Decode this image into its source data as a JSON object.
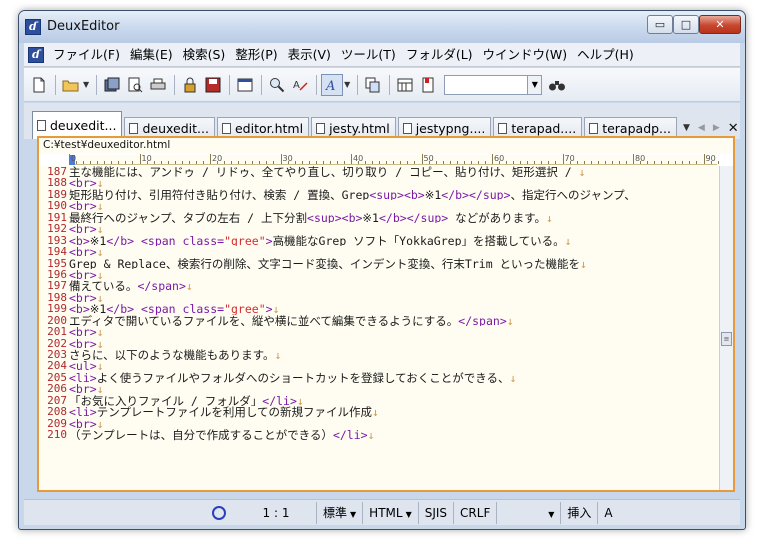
{
  "window": {
    "title": "DeuxEditor",
    "icon": "deuxeditor-app-icon",
    "controls": {
      "minimize": "▭",
      "maximize": "□",
      "close": "✕"
    }
  },
  "menu": [
    {
      "label": "ファイル(F)"
    },
    {
      "label": "編集(E)"
    },
    {
      "label": "検索(S)"
    },
    {
      "label": "整形(P)"
    },
    {
      "label": "表示(V)"
    },
    {
      "label": "ツール(T)"
    },
    {
      "label": "フォルダ(L)"
    },
    {
      "label": "ウインドウ(W)"
    },
    {
      "label": "ヘルプ(H)"
    }
  ],
  "toolbar": {
    "search_combo_value": "",
    "icons": [
      "new-file-icon",
      "open-folder-icon",
      "save-all-icon",
      "print-preview-icon",
      "print-icon",
      "lock-icon",
      "save-icon",
      "window-icon",
      "search-icon",
      "spell-icon",
      "font-icon",
      "copy-icon",
      "calendar-icon",
      "bookmark-icon",
      "binoculars-icon"
    ]
  },
  "tabs": [
    {
      "label": "deuxedit...",
      "active": true
    },
    {
      "label": "deuxedit...",
      "active": false
    },
    {
      "label": "editor.html",
      "active": false
    },
    {
      "label": "jesty.html",
      "active": false
    },
    {
      "label": "jestypng....",
      "active": false
    },
    {
      "label": "terapad....",
      "active": false
    },
    {
      "label": "terapadp...",
      "active": false
    }
  ],
  "editor": {
    "path": "C:¥test¥deuxeditor.html",
    "ruler": [
      "0",
      "10",
      "20",
      "30",
      "40",
      "50",
      "60",
      "70",
      "80",
      "90"
    ],
    "accent_color": "#e79a3c",
    "lines": [
      {
        "n": "187",
        "text": "主な機能には、アンドゥ / リドゥ、全てやり直し、切り取り / コピー、貼り付け、矩形選択 / ↓"
      },
      {
        "n": "188",
        "text": "<br>↓"
      },
      {
        "n": "189",
        "text": "矩形貼り付け、引用符付き貼り付け、検索 / 置換、Grep<sup><b>※1</b></sup>、指定行へのジャンプ、"
      },
      {
        "n": "190",
        "text": "<br>↓"
      },
      {
        "n": "191",
        "text": "最終行へのジャンプ、タブの左右 / 上下分割<sup><b>※1</b></sup> などがあります。↓"
      },
      {
        "n": "192",
        "text": "<br>↓"
      },
      {
        "n": "193",
        "text": "<b>※1</b> <span class=\"gree\">高機能なGrep ソフト「YokkaGrep」を搭載している。↓"
      },
      {
        "n": "194",
        "text": "<br>↓"
      },
      {
        "n": "195",
        "text": "Grep & Replace、検索行の削除、文字コード変換、インデント変換、行末Trim といった機能を↓"
      },
      {
        "n": "196",
        "text": "<br>↓"
      },
      {
        "n": "197",
        "text": "備えている。</span>↓"
      },
      {
        "n": "198",
        "text": "<br>↓"
      },
      {
        "n": "199",
        "text": "<b>※1</b> <span class=\"gree\">↓"
      },
      {
        "n": "200",
        "text": "エディタで開いているファイルを、縦や横に並べて編集できるようにする。</span>↓"
      },
      {
        "n": "201",
        "text": "<br>↓"
      },
      {
        "n": "202",
        "text": "<br>↓"
      },
      {
        "n": "203",
        "text": "さらに、以下のような機能もあります。↓"
      },
      {
        "n": "204",
        "text": "<ul>↓"
      },
      {
        "n": "205",
        "text": "<li>よく使うファイルやフォルダへのショートカットを登録しておくことができる、↓"
      },
      {
        "n": "206",
        "text": "<br>↓"
      },
      {
        "n": "207",
        "text": "「お気に入りファイル / フォルダ」</li>↓"
      },
      {
        "n": "208",
        "text": "<li>テンプレートファイルを利用しての新規ファイル作成↓"
      },
      {
        "n": "209",
        "text": "<br>↓"
      },
      {
        "n": "210",
        "text": "（テンプレートは、自分で作成することができる）</li>↓"
      }
    ]
  },
  "status": {
    "indicator": "status-circle-icon",
    "position": "1 : 1",
    "style": "標準",
    "mode": "HTML",
    "encoding": "SJIS",
    "line_ending": "CRLF",
    "extra": "",
    "insert": "挿入",
    "ime": "A"
  }
}
